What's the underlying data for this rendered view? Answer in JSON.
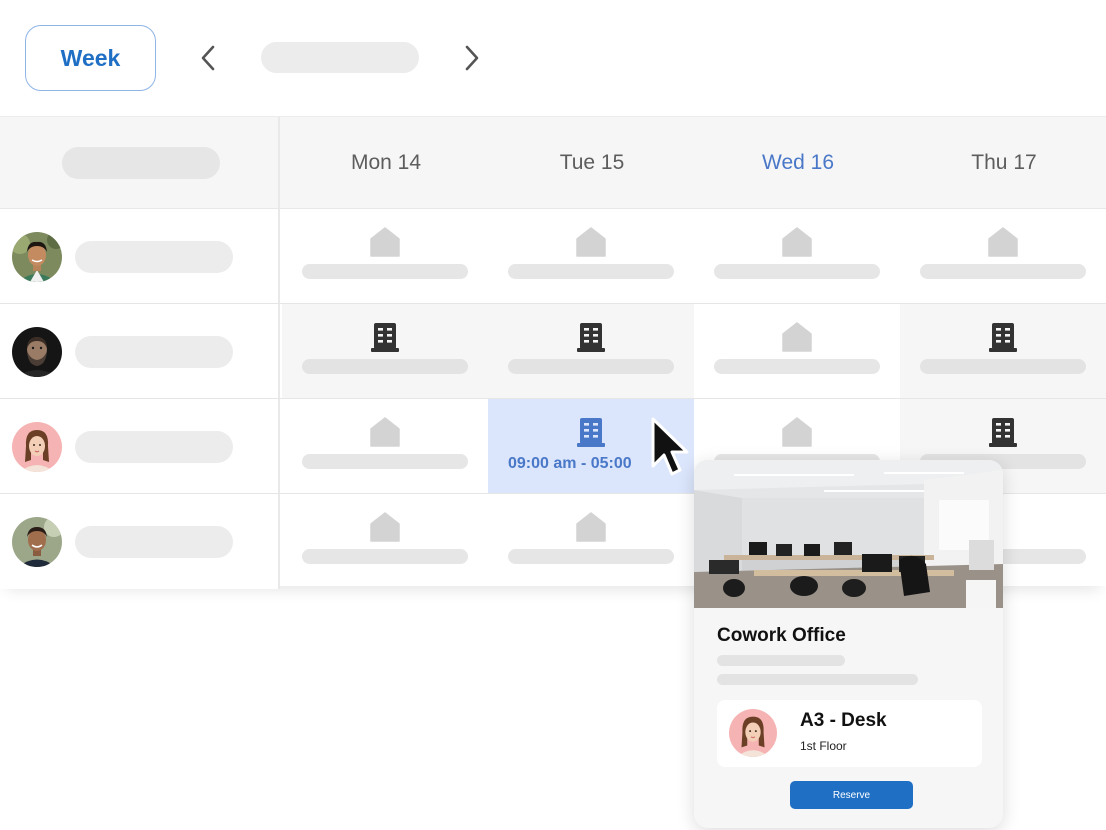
{
  "toolbar": {
    "view_label": "Week",
    "prev_icon": "chevron-left-icon",
    "next_icon": "chevron-right-icon"
  },
  "days": [
    {
      "label": "Mon 14",
      "active": false
    },
    {
      "label": "Tue 15",
      "active": false
    },
    {
      "label": "Wed 16",
      "active": true
    },
    {
      "label": "Thu 17",
      "active": false
    }
  ],
  "colors": {
    "accent": "#1f6fc4",
    "active_day": "#4a78c8",
    "selected_cell": "#dbe5fb",
    "home_icon": "#d3d3d3",
    "office_icon": "#333333"
  },
  "rows": [
    {
      "avatar": "avatar-man-green-shirt",
      "cells": [
        "home",
        "home",
        "home",
        "home"
      ]
    },
    {
      "avatar": "avatar-bearded-man",
      "cells": [
        "office",
        "office",
        "home",
        "office"
      ]
    },
    {
      "avatar": "avatar-woman",
      "cells": [
        "home",
        "office-selected",
        "home",
        "office"
      ]
    },
    {
      "avatar": "avatar-smiling-man",
      "cells": [
        "home",
        "home",
        "hidden",
        "hidden"
      ]
    }
  ],
  "selected_cell": {
    "time": "09:00 am - 05:00"
  },
  "popup": {
    "title": "Cowork Office",
    "desk_name": "A3 - Desk",
    "desk_floor": "1st Floor",
    "reserve_label": "Reserve"
  }
}
